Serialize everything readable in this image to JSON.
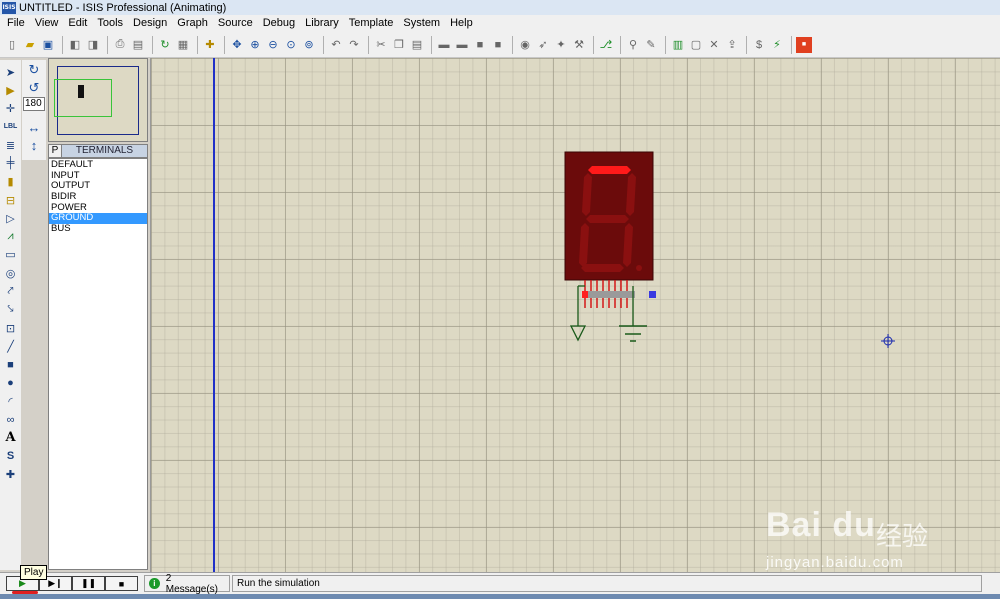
{
  "window": {
    "logo_text": "ISIS",
    "title": "UNTITLED - ISIS Professional (Animating)"
  },
  "menu": [
    "File",
    "View",
    "Edit",
    "Tools",
    "Design",
    "Graph",
    "Source",
    "Debug",
    "Library",
    "Template",
    "System",
    "Help"
  ],
  "toolbar_icons": [
    "new-file-icon",
    "open-file-icon",
    "save-icon",
    "import-icon",
    "export-icon",
    "print-icon",
    "print-area-icon",
    "refresh-icon",
    "grid-icon",
    "origin-icon",
    "pan-icon",
    "zoom-in-icon",
    "zoom-out-icon",
    "zoom-all-icon",
    "zoom-area-icon",
    "undo-icon",
    "redo-icon",
    "cut-icon",
    "copy-icon",
    "paste-icon",
    "block-copy-icon",
    "block-move-icon",
    "block-rotate-icon",
    "block-delete-icon",
    "pick-device-icon",
    "make-device-icon",
    "packaging-tool-icon",
    "decompose-icon",
    "wire-autorouter-icon",
    "search-tag-icon",
    "property-tool-icon",
    "design-explorer-icon",
    "new-sheet-icon",
    "remove-sheet-icon",
    "exit-parent-icon",
    "bom-icon",
    "erc-icon",
    "ares-icon"
  ],
  "mode_icons": [
    "selection-mode-icon",
    "component-mode-icon",
    "junction-dot-icon",
    "wire-label-icon",
    "text-script-icon",
    "bus-icon",
    "subcircuit-icon",
    "terminals-mode-icon",
    "device-pins-icon",
    "graph-mode-icon",
    "tape-recorder-icon",
    "generator-icon",
    "voltage-probe-icon",
    "current-probe-icon",
    "virtual-instruments-icon",
    "line-icon",
    "box-icon",
    "circle-icon",
    "arc-icon",
    "path-icon",
    "text-icon",
    "symbol-icon",
    "marker-icon"
  ],
  "rotation": {
    "rotate_cw": "rotate-clockwise-icon",
    "rotate_ccw": "rotate-anticlockwise-icon",
    "angle": "180",
    "mirror_x": "mirror-horizontal-icon",
    "mirror_y": "mirror-vertical-icon"
  },
  "selector": {
    "p_button": "P",
    "title": "TERMINALS",
    "items": [
      "DEFAULT",
      "INPUT",
      "OUTPUT",
      "BIDIR",
      "POWER",
      "GROUND",
      "BUS"
    ],
    "selected": "GROUND"
  },
  "display": {
    "active_segments": [
      "a"
    ],
    "segment_on_color": "#ff1a1a",
    "segment_off_color": "#8a1010",
    "body_color": "#6b0b0b"
  },
  "simulation": {
    "tooltip": "Play",
    "message_count": "2 Message(s)",
    "status": "Run the simulation"
  },
  "watermark": {
    "brand": "Bai du",
    "text": "经验",
    "url": "jingyan.baidu.com"
  },
  "colors": {
    "canvas": "#ddd9c4",
    "sheet_border": "#2030c8",
    "wire": "#1a5a1a"
  }
}
